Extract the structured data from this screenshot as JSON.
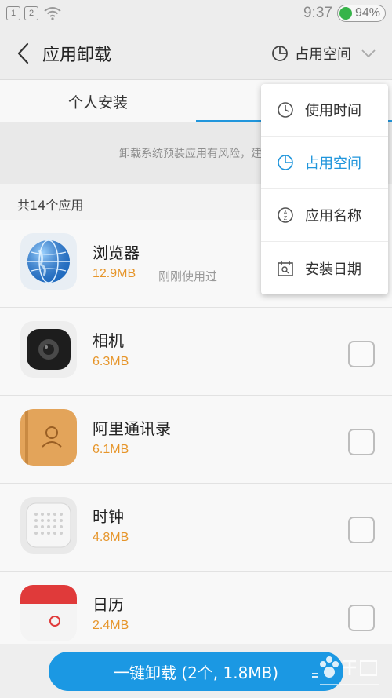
{
  "status_bar": {
    "sim1": "1",
    "sim2": "2",
    "time": "9:37",
    "battery": "94%"
  },
  "header": {
    "title": "应用卸载",
    "sort_label": "占用空间"
  },
  "tabs": [
    {
      "label": "个人安装",
      "active": false
    },
    {
      "label": "",
      "active": true
    }
  ],
  "warning": "卸载系统预装应用有风险，建议",
  "app_count": "共14个应用",
  "apps": [
    {
      "name": "浏览器",
      "size": "12.9MB",
      "last_used": "刚刚使用过",
      "icon": "browser-globe-icon"
    },
    {
      "name": "相机",
      "size": "6.3MB",
      "last_used": "",
      "icon": "camera-icon"
    },
    {
      "name": "阿里通讯录",
      "size": "6.1MB",
      "last_used": "",
      "icon": "contacts-book-icon"
    },
    {
      "name": "时钟",
      "size": "4.8MB",
      "last_used": "",
      "icon": "clock-app-icon"
    },
    {
      "name": "日历",
      "size": "2.4MB",
      "last_used": "",
      "icon": "calendar-icon"
    }
  ],
  "sort_menu": [
    {
      "label": "使用时间",
      "icon": "clock-icon",
      "selected": false
    },
    {
      "label": "占用空间",
      "icon": "pie-chart-icon",
      "selected": true
    },
    {
      "label": "应用名称",
      "icon": "az-sort-icon",
      "selected": false
    },
    {
      "label": "安装日期",
      "icon": "calendar-search-icon",
      "selected": false
    }
  ],
  "bottom_button": "一键卸载 (2个, 1.8MB)",
  "colors": {
    "accent": "#2196dc",
    "size_text": "#e6952a",
    "button": "#1b98e3"
  }
}
